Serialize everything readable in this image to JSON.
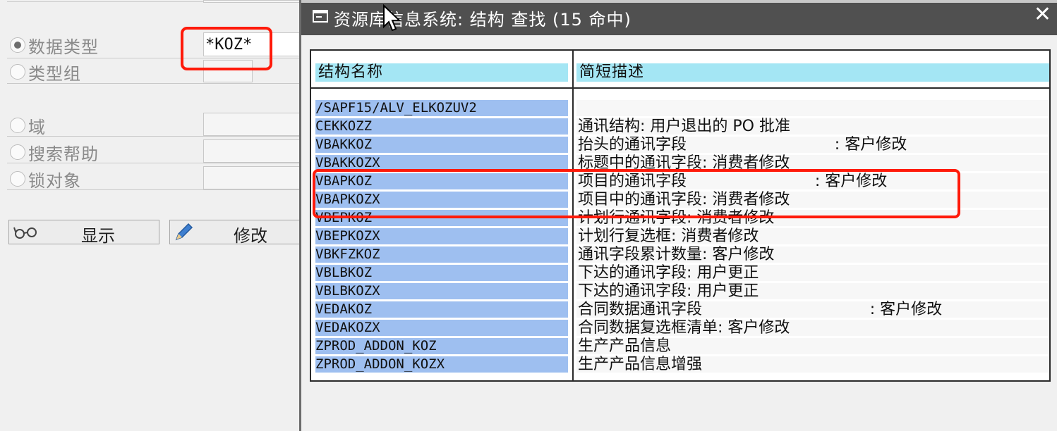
{
  "left_panel": {
    "radios": [
      {
        "label": "数据类型",
        "checked": true
      },
      {
        "label": "类型组",
        "checked": false
      },
      {
        "label": "域",
        "checked": false
      },
      {
        "label": "搜索帮助",
        "checked": false
      },
      {
        "label": "锁对象",
        "checked": false
      }
    ],
    "data_type_value": "*KOZ*",
    "buttons": {
      "display_label": "显示",
      "change_label": "修改"
    }
  },
  "dialog": {
    "title": "资源库信息系统: 结构 查找 (15 命中)",
    "close_symbol": "✕",
    "columns": {
      "name": "结构名称",
      "description": "简短描述"
    },
    "rows": [
      {
        "name": "/SAPF15/ALV_ELKOZUV2",
        "desc": ""
      },
      {
        "name": "CEKKOZZ",
        "desc": "通讯结构: 用户退出的 PO 批准"
      },
      {
        "name": "VBAKKOZ",
        "desc": "抬头的通讯字段                              : 客户修改"
      },
      {
        "name": "VBAKKOZX",
        "desc": "标题中的通讯字段: 消费者修改"
      },
      {
        "name": "VBAPKOZ",
        "desc": "项目的通讯字段                          : 客户修改"
      },
      {
        "name": "VBAPKOZX",
        "desc": "项目中的通讯字段: 消费者修改"
      },
      {
        "name": "VBEPKOZ",
        "desc": "计划行通讯字段: 消费者修改"
      },
      {
        "name": "VBEPKOZX",
        "desc": "计划行复选框: 消费者修改"
      },
      {
        "name": "VBKFZKOZ",
        "desc": "通讯字段累计数量: 客户修改"
      },
      {
        "name": "VBLBKOZ",
        "desc": "下达的通讯字段: 用户更正"
      },
      {
        "name": "VBLBKOZX",
        "desc": "下达的通讯字段: 用户更正"
      },
      {
        "name": "VEDAKOZ",
        "desc": "合同数据通讯字段                                  : 客户修改"
      },
      {
        "name": "VEDAKOZX",
        "desc": "合同数据复选框清单: 客户修改"
      },
      {
        "name": "ZPROD_ADDON_KOZ",
        "desc": "生产产品信息"
      },
      {
        "name": "ZPROD_ADDON_KOZX",
        "desc": "生产产品信息增强"
      }
    ]
  },
  "colors": {
    "highlight": "#ff1a0a",
    "header_cell": "#a4e6f4",
    "name_cell": "#9ebff0",
    "titlebar": "#505050"
  },
  "icons": [
    "glasses-icon",
    "pencil-icon",
    "dialog-icon",
    "close-icon",
    "mouse-cursor-icon"
  ]
}
